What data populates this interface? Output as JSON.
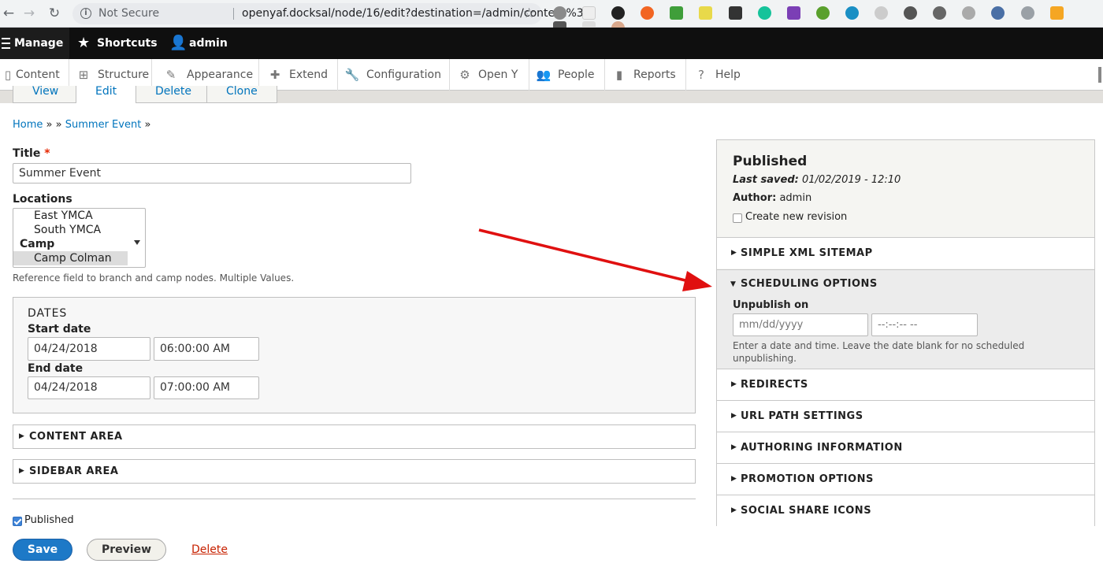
{
  "browser": {
    "security_label": "Not Secure",
    "url": "openyaf.docksal/node/16/edit?destination=/admin/content%3Ftitl...",
    "extension_icons": [
      "opera-icon",
      "y-icon",
      "chrome-icon",
      "record-icon",
      "jquery-icon",
      "css-icon",
      "terminal-icon",
      "grammarly-icon",
      "rp-icon",
      "gear-icon",
      "circle-icon",
      "whatfont-icon",
      "w-icon",
      "pie-icon",
      "drive-icon",
      "eye-icon",
      "vue-icon",
      "grid-icon",
      "barcode-icon",
      "html-icon",
      "profile-avatar"
    ]
  },
  "toolbar": {
    "manage": "Manage",
    "shortcuts": "Shortcuts",
    "user": "admin"
  },
  "tray": {
    "items": [
      {
        "label": "Content",
        "icon": "file-icon"
      },
      {
        "label": "Structure",
        "icon": "sitemap-icon"
      },
      {
        "label": "Appearance",
        "icon": "brush-icon"
      },
      {
        "label": "Extend",
        "icon": "puzzle-icon"
      },
      {
        "label": "Configuration",
        "icon": "wrench-icon"
      },
      {
        "label": "Open Y",
        "icon": "gear-icon"
      },
      {
        "label": "People",
        "icon": "people-icon"
      },
      {
        "label": "Reports",
        "icon": "chart-icon"
      },
      {
        "label": "Help",
        "icon": "help-icon"
      }
    ]
  },
  "tabs": [
    "View",
    "Edit",
    "Delete",
    "Clone"
  ],
  "breadcrumb": {
    "home": "Home",
    "sep": "»",
    "current": "Summer Event"
  },
  "form": {
    "title_label": "Title",
    "title_value": "Summer Event",
    "locations_label": "Locations",
    "locations_options": [
      "East YMCA",
      "South YMCA"
    ],
    "locations_group": "Camp",
    "locations_selected": "Camp Colman",
    "locations_desc": "Reference field to branch and camp nodes. Multiple Values.",
    "dates_legend": "DATES",
    "start_label": "Start date",
    "start_date": "04/24/2018",
    "start_time": "06:00:00 AM",
    "end_label": "End date",
    "end_date": "04/24/2018",
    "end_time": "07:00:00 AM",
    "content_area": "CONTENT AREA",
    "sidebar_area": "SIDEBAR AREA",
    "published_label": "Published",
    "save": "Save",
    "preview": "Preview",
    "delete": "Delete"
  },
  "sidebar": {
    "status": "Published",
    "last_saved_label": "Last saved:",
    "last_saved_value": "01/02/2019 - 12:10",
    "author_label": "Author:",
    "author_value": "admin",
    "revision_label": "Create new revision",
    "sections": [
      "SIMPLE XML SITEMAP",
      "SCHEDULING OPTIONS",
      "REDIRECTS",
      "URL PATH SETTINGS",
      "AUTHORING INFORMATION",
      "PROMOTION OPTIONS",
      "SOCIAL SHARE ICONS"
    ],
    "unpublish_label": "Unpublish on",
    "unpublish_date_placeholder": "mm/dd/yyyy",
    "unpublish_time_placeholder": "--:--:-- --",
    "unpublish_desc": "Enter a date and time. Leave the date blank for no scheduled unpublishing."
  },
  "colors": {
    "link": "#0074bd",
    "required": "#e62600",
    "arrow": "#e01010",
    "save_button": "#1d79c7"
  }
}
